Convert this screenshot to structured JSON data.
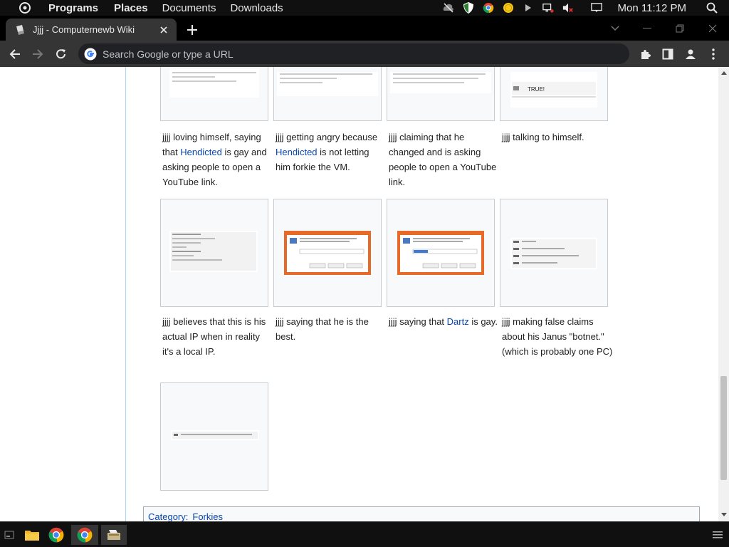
{
  "os_panel": {
    "menus": [
      "Programs",
      "Places",
      "Documents",
      "Downloads"
    ],
    "clock": "Mon 11:12 PM"
  },
  "browser": {
    "tab_title": "Jjjj - Computernewb Wiki",
    "omnibox_placeholder": "Search Google or type a URL"
  },
  "gallery": [
    {
      "caption_parts": [
        "jjjj loving himself, saying that ",
        "Hendicted",
        " is gay and asking people to open a YouTube link."
      ]
    },
    {
      "caption_parts": [
        "jjjj getting angry because ",
        "Hendicted",
        " is not letting him forkie the VM."
      ]
    },
    {
      "caption_parts": [
        "jjjj claiming that he changed and is asking people to open a YouTube link.",
        "",
        ""
      ]
    },
    {
      "caption_parts": [
        "jjjj talking to himself.",
        "",
        ""
      ],
      "thumb_text": "TRUE!"
    },
    {
      "caption_parts": [
        "jjjj believes that this is his actual IP when in reality it's a local IP.",
        "",
        ""
      ]
    },
    {
      "caption_parts": [
        "jjjj saying that he is the best.",
        "",
        ""
      ]
    },
    {
      "caption_parts": [
        "jjjj saying that ",
        "Dartz",
        " is gay."
      ]
    },
    {
      "caption_parts": [
        "jjjj making false claims about his Janus \"botnet.\" (which is probably one PC)",
        "",
        ""
      ]
    },
    {
      "caption_parts": [
        "",
        "",
        ""
      ]
    }
  ],
  "catlinks": {
    "label": "Category",
    "category": "Forkies"
  },
  "colors": {
    "link": "#0645ad",
    "chrome_dark": "#353535",
    "tab_strip": "#000000"
  }
}
